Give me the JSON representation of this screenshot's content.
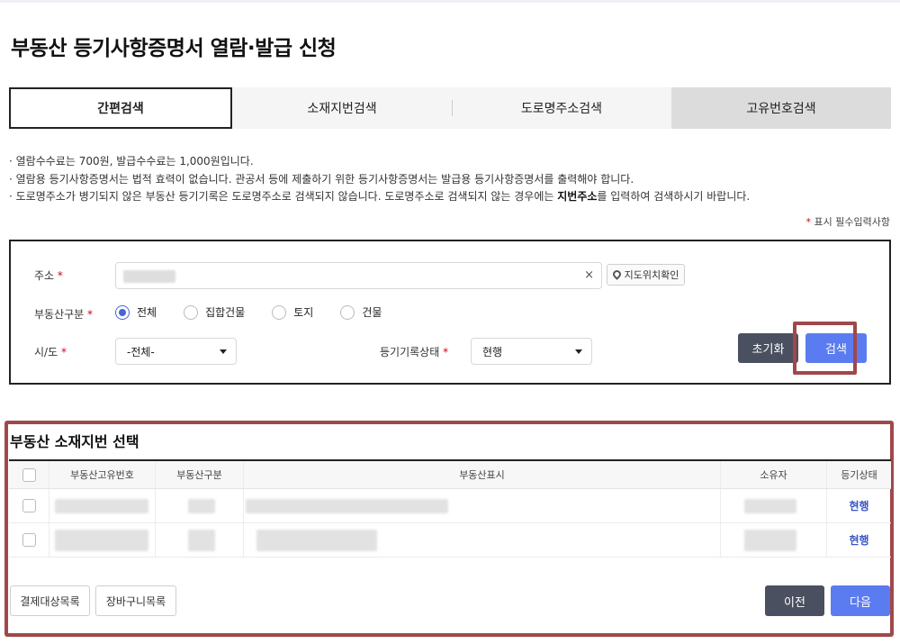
{
  "page": {
    "title": "부동산 등기사항증명서 열람·발급 신청"
  },
  "tabs": [
    {
      "label": "간편검색",
      "active": true
    },
    {
      "label": "소재지번검색",
      "active": false
    },
    {
      "label": "도로명주소검색",
      "active": false
    },
    {
      "label": "고유번호검색",
      "active": false
    }
  ],
  "notices": {
    "line1": "열람수수료는  700원, 발급수수료는  1,000원입니다.",
    "line2": "열람용 등기사항증명서는 법적 효력이 없습니다. 관공서 등에 제출하기 위한 등기사항증명서는 발급용 등기사항증명서를 출력해야 합니다.",
    "line3_pre": "도로명주소가 병기되지 않은 부동산 등기기록은 도로명주소로 검색되지 않습니다. 도로명주소로 검색되지 않는 경우에는 ",
    "line3_bold": "지번주소",
    "line3_post": "를 입력하여 검색하시기 바랍니다."
  },
  "required_note": {
    "star": "*",
    "text": " 표시 필수입력사항"
  },
  "form": {
    "address_label": "주소",
    "required_star": "*",
    "clear_symbol": "×",
    "location_button": "지도위치확인",
    "type_label": "부동산구분",
    "type_options": [
      "전체",
      "집합건물",
      "토지",
      "건물"
    ],
    "type_selected": "전체",
    "sido_label": "시/도",
    "sido_value": "-전체-",
    "status_label": "등기기록상태",
    "status_value": "현행",
    "reset_button": "초기화",
    "search_button": "검색"
  },
  "results": {
    "title": "부동산 소재지번 선택",
    "columns": [
      "부동산고유번호",
      "부동산구분",
      "부동산표시",
      "소유자",
      "등기상태"
    ],
    "rows": [
      {
        "status": "현행"
      },
      {
        "status": "현행"
      }
    ],
    "payment_list_button": "결제대상목록",
    "cart_button": "장바구니목록",
    "prev_button": "이전",
    "next_button": "다음"
  },
  "colors": {
    "accent_blue": "#5b7cf0",
    "dark_button": "#4a5060",
    "highlight_border": "#a0484a",
    "required_red": "#d0021b"
  }
}
